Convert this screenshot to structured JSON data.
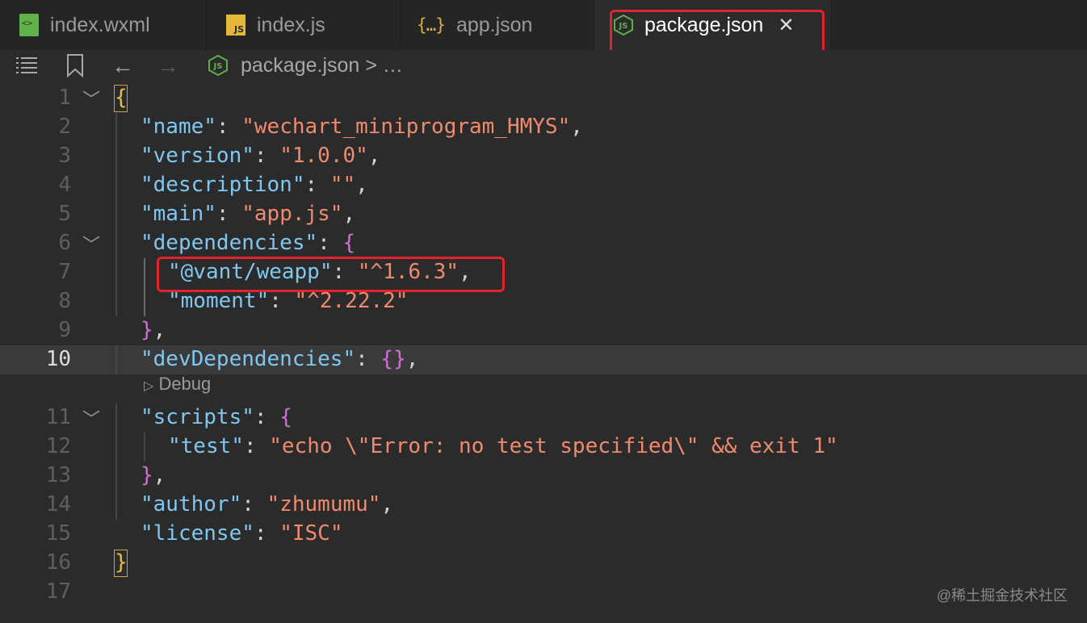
{
  "tabs": [
    {
      "label": "index.wxml",
      "icon": "wxml-file-icon",
      "active": false
    },
    {
      "label": "index.js",
      "icon": "js-file-icon",
      "active": false
    },
    {
      "label": "app.json",
      "icon": "json-file-icon",
      "active": false
    },
    {
      "label": "package.json",
      "icon": "node-file-icon",
      "active": true
    }
  ],
  "breadcrumb": {
    "file": "package.json",
    "trail": "> …"
  },
  "codelens": "Debug",
  "lines": [
    {
      "n": "1"
    },
    {
      "n": "2"
    },
    {
      "n": "3"
    },
    {
      "n": "4"
    },
    {
      "n": "5"
    },
    {
      "n": "6"
    },
    {
      "n": "7"
    },
    {
      "n": "8"
    },
    {
      "n": "9"
    },
    {
      "n": "10"
    },
    {
      "n": "11"
    },
    {
      "n": "12"
    },
    {
      "n": "13"
    },
    {
      "n": "14"
    },
    {
      "n": "15"
    },
    {
      "n": "16"
    },
    {
      "n": "17"
    }
  ],
  "code": {
    "l1_open": "{",
    "name_key": "\"name\"",
    "name_val": "\"wechart_miniprogram_HMYS\"",
    "version_key": "\"version\"",
    "version_val": "\"1.0.0\"",
    "desc_key": "\"description\"",
    "desc_val": "\"\"",
    "main_key": "\"main\"",
    "main_val": "\"app.js\"",
    "deps_key": "\"dependencies\"",
    "vant_key": "\"@vant/weapp\"",
    "vant_val": "\"^1.6.3\"",
    "moment_key": "\"moment\"",
    "moment_val": "\"^2.22.2\"",
    "devdeps_key": "\"devDependencies\"",
    "devdeps_val": "{}",
    "scripts_key": "\"scripts\"",
    "test_key": "\"test\"",
    "test_val": "\"echo \\\"Error: no test specified\\\" && exit 1\"",
    "author_key": "\"author\"",
    "author_val": "\"zhumumu\"",
    "license_key": "\"license\"",
    "license_val": "\"ISC\"",
    "l16_close": "}",
    "colon": ": ",
    "comma": ",",
    "open_brace": "{",
    "close_brace": "}",
    "close_brace_comma": "},"
  },
  "watermark": "@稀土掘金技术社区",
  "colors": {
    "background": "#2b2b2b",
    "key": "#7fc7f0",
    "string": "#f08a6f",
    "bracket_gold": "#e2c04a",
    "bracket_purple": "#d070d6",
    "highlight_red": "#e0242b"
  }
}
